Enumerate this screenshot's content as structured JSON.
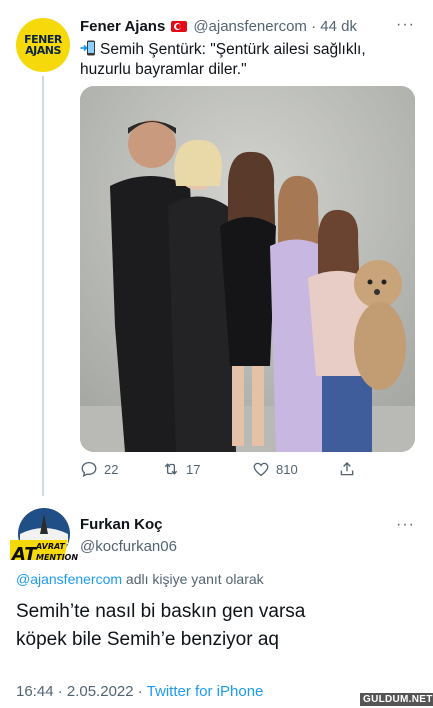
{
  "tweet1": {
    "author_name": "Fener Ajans",
    "handle": "@ajansfenercom",
    "time": "· 44 dk",
    "avatar_text_top": "FENER",
    "avatar_text_bottom": "AJANS",
    "text": "Semih Şentürk: \"Şentürk ailesi sağlıklı, huzurlu bayramlar diler.\"",
    "replies": "22",
    "retweets": "17",
    "likes": "810",
    "more": "···"
  },
  "tweet2": {
    "author_name": "Furkan Koç",
    "handle": "@kocfurkan06",
    "avatar_badge_top": "AVRAT",
    "avatar_badge_main": "AT",
    "avatar_badge_bottom": "MENTION",
    "reply_to_handle": "@ajansfenercom",
    "reply_to_suffix": " adlı kişiye yanıt olarak",
    "text_line1": "Semih’te nasıl bi baskın gen varsa",
    "text_line2": "köpek bile Semih’e benziyor aq",
    "timestamp": "16:44 · 2.05.2022 · ",
    "source": "Twitter for iPhone",
    "more": "···"
  },
  "watermark": "GULDUM.NET",
  "colors": {
    "link": "#1d9bf0",
    "secondary_text": "#536471",
    "primary_text": "#0f1419",
    "fener_yellow": "#f5d90a",
    "fener_navy": "#0c2340"
  }
}
